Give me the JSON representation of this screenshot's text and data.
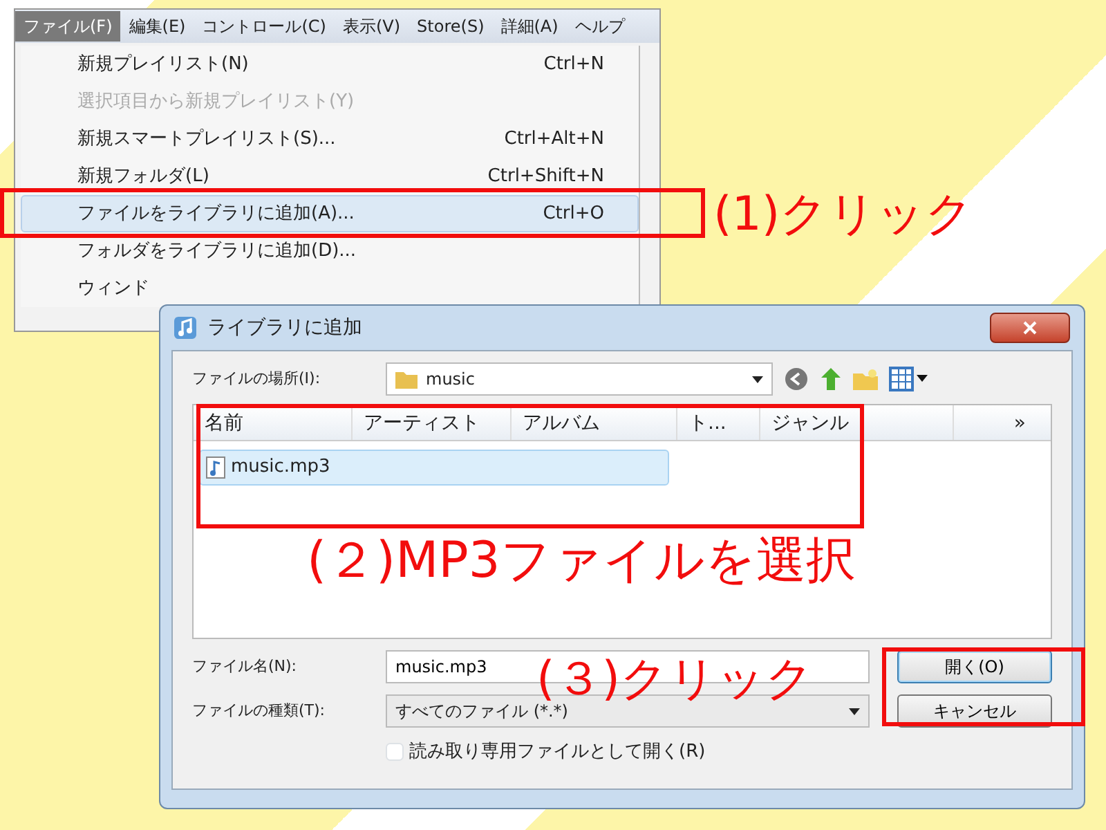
{
  "menu_bar": [
    {
      "label": "ファイル(F)",
      "selected": true
    },
    {
      "label": "編集(E)",
      "selected": false
    },
    {
      "label": "コントロール(C)",
      "selected": false
    },
    {
      "label": "表示(V)",
      "selected": false
    },
    {
      "label": "Store(S)",
      "selected": false
    },
    {
      "label": "詳細(A)",
      "selected": false
    },
    {
      "label": "ヘルプ",
      "selected": false
    }
  ],
  "menu_items": [
    {
      "label": "新規プレイリスト(N)",
      "shortcut": "Ctrl+N",
      "disabled": false,
      "selected": false
    },
    {
      "label": "選択項目から新規プレイリスト(Y)",
      "disabled": true,
      "selected": false
    },
    {
      "label": "新規スマートプレイリスト(S)...",
      "shortcut": "Ctrl+Alt+N",
      "disabled": false,
      "selected": false
    },
    {
      "label": "新規フォルダ(L)",
      "shortcut": "Ctrl+Shift+N",
      "disabled": false,
      "selected": false
    },
    {
      "label": "ファイルをライブラリに追加(A)...",
      "shortcut": "Ctrl+O",
      "disabled": false,
      "selected": true
    },
    {
      "label": "フォルダをライブラリに追加(D)...",
      "disabled": false,
      "selected": false
    },
    {
      "label": "ウィンド",
      "disabled": false,
      "selected": false
    }
  ],
  "dialog": {
    "title": "ライブラリに追加",
    "location_label": "ファイルの場所(I):",
    "location": "music",
    "columns": [
      "名前",
      "アーティスト",
      "アルバム",
      "ト...",
      "ジャンル",
      "»"
    ],
    "files": [
      {
        "name": "music.mp3",
        "selected": true
      }
    ],
    "filename_label": "ファイル名(N):",
    "filename": "music.mp3",
    "filetype_label": "ファイルの種類(T):",
    "filetype": "すべてのファイル (*.*)",
    "readonly": {
      "label": "読み取り専用ファイルとして開く(R)",
      "checked": false
    },
    "buttons": [
      "開く(O)",
      "キャンセル"
    ]
  },
  "annotations": [
    "(1)クリック",
    "(２)MP3ファイルを選択",
    "(３)クリック"
  ]
}
